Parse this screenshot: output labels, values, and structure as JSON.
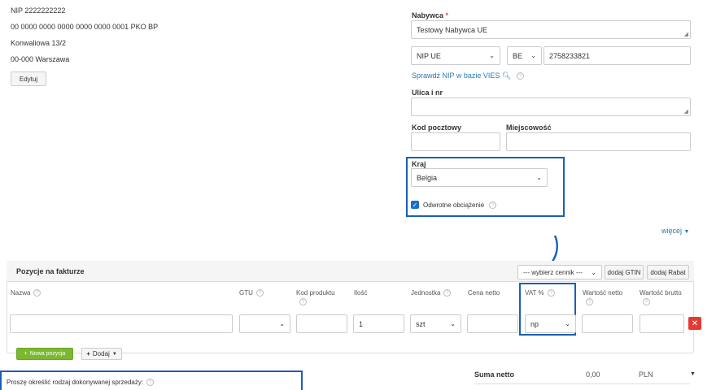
{
  "seller": {
    "nip": "NIP 2222222222",
    "account": "00 0000 0000 0000 0000 0000 0001 PKO BP",
    "street": "Konwaliowa 13/2",
    "city": "00-000 Warszawa",
    "edit_label": "Edytuj"
  },
  "buyer": {
    "label": "Nabywca",
    "required_mark": "*",
    "name_value": "Testowy Nabywca UE",
    "nip_type": "NIP UE",
    "country_code": "BE",
    "nip_value": "2758233821",
    "vies_link": "Sprawdź NIP w bazie VIES",
    "street_label": "Ulica i nr",
    "postal_label": "Kod pocztowy",
    "city_label": "Miejscowość",
    "country_label": "Kraj",
    "country_value": "Belgia",
    "reverse_charge_label": "Odwrotne obciążenie",
    "more_link": "więcej"
  },
  "positions": {
    "title": "Pozycje na fakturze",
    "price_list": "--- wybierz cennik ---",
    "add_gtin": "dodaj GTIN",
    "add_discount": "dodaj Rabat",
    "columns": {
      "name": "Nazwa",
      "gtu": "GTU",
      "product_code": "Kod produktu",
      "qty": "Ilość",
      "unit": "Jednostka",
      "net_price": "Cena netto",
      "vat": "VAT %",
      "net_value": "Wartość netto",
      "gross_value": "Wartość brutto"
    },
    "row": {
      "qty": "1",
      "unit": "szt",
      "vat": "np"
    },
    "new_position": "Nowa pozycja",
    "add": "Dodaj"
  },
  "footer": {
    "sale_type_prompt": "Proszę określić rodzaj dokonywanej sprzedaży:",
    "net_sum_label": "Suma netto",
    "net_sum_value": "0,00",
    "currency": "PLN"
  },
  "colors": {
    "highlight": "#1a5fb4",
    "link": "#2a7ab0",
    "green_button": "#7cb82f",
    "delete_red": "#e53935"
  }
}
